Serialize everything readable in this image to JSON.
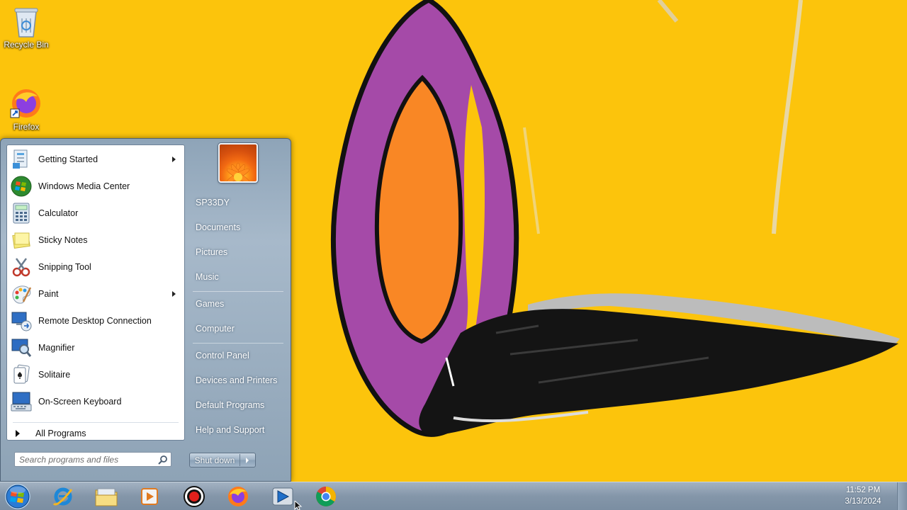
{
  "desktop": {
    "icons": [
      {
        "label": "Recycle Bin",
        "icon": "recycle-bin-icon"
      },
      {
        "label": "Firefox",
        "icon": "firefox-icon"
      }
    ],
    "wallpaper_colors": {
      "background": "#fcc40c",
      "purple": "#a54aa8",
      "orange": "#f98725",
      "black": "#111111"
    }
  },
  "start_menu": {
    "programs": [
      {
        "label": "Getting Started",
        "icon": "getting-started-icon",
        "has_submenu": true
      },
      {
        "label": "Windows Media Center",
        "icon": "media-center-icon",
        "has_submenu": false
      },
      {
        "label": "Calculator",
        "icon": "calculator-icon",
        "has_submenu": false
      },
      {
        "label": "Sticky Notes",
        "icon": "sticky-notes-icon",
        "has_submenu": false
      },
      {
        "label": "Snipping Tool",
        "icon": "snipping-tool-icon",
        "has_submenu": false
      },
      {
        "label": "Paint",
        "icon": "paint-icon",
        "has_submenu": true
      },
      {
        "label": "Remote Desktop Connection",
        "icon": "remote-desktop-icon",
        "has_submenu": false
      },
      {
        "label": "Magnifier",
        "icon": "magnifier-icon",
        "has_submenu": false
      },
      {
        "label": "Solitaire",
        "icon": "solitaire-icon",
        "has_submenu": false
      },
      {
        "label": "On-Screen Keyboard",
        "icon": "keyboard-icon",
        "has_submenu": false
      }
    ],
    "all_programs_label": "All Programs",
    "search_placeholder": "Search programs and files",
    "right_items": [
      "SP33DY",
      "Documents",
      "Pictures",
      "Music",
      "Games",
      "Computer",
      "Control Panel",
      "Devices and Printers",
      "Default Programs",
      "Help and Support"
    ],
    "shutdown_label": "Shut down"
  },
  "taskbar": {
    "pinned": [
      {
        "name": "internet-explorer",
        "icon": "internet-explorer-icon"
      },
      {
        "name": "file-explorer",
        "icon": "folder-icon"
      },
      {
        "name": "media-player",
        "icon": "media-player-icon"
      },
      {
        "name": "recorder",
        "icon": "record-icon"
      },
      {
        "name": "firefox",
        "icon": "firefox-icon"
      },
      {
        "name": "player",
        "icon": "play-icon"
      },
      {
        "name": "chrome",
        "icon": "chrome-icon"
      }
    ],
    "clock": {
      "time": "11:52 PM",
      "date": "3/13/2024"
    }
  }
}
